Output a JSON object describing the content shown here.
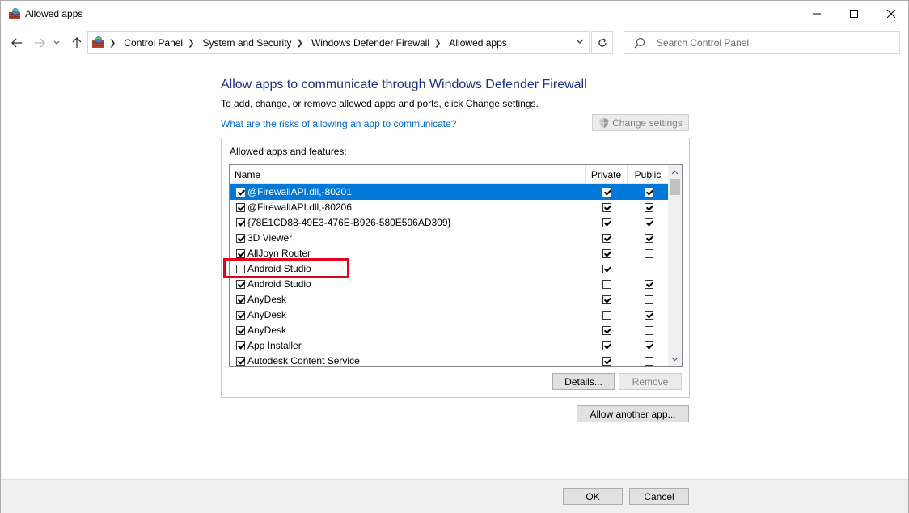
{
  "window": {
    "title": "Allowed apps"
  },
  "nav": {
    "breadcrumbs": [
      "Control Panel",
      "System and Security",
      "Windows Defender Firewall",
      "Allowed apps"
    ],
    "search_placeholder": "Search Control Panel"
  },
  "content": {
    "heading": "Allow apps to communicate through Windows Defender Firewall",
    "subtext": "To add, change, or remove allowed apps and ports, click Change settings.",
    "risk_link": "What are the risks of allowing an app to communicate?",
    "change_settings_label": "Change settings",
    "group_label": "Allowed apps and features:",
    "columns": {
      "name": "Name",
      "private": "Private",
      "public": "Public"
    },
    "apps": [
      {
        "name": "@FirewallAPI.dll,-80201",
        "enabled": true,
        "private": true,
        "public": true,
        "selected": true
      },
      {
        "name": "@FirewallAPI.dll,-80206",
        "enabled": true,
        "private": true,
        "public": true
      },
      {
        "name": "{78E1CD88-49E3-476E-B926-580E596AD309}",
        "enabled": true,
        "private": true,
        "public": true
      },
      {
        "name": "3D Viewer",
        "enabled": true,
        "private": true,
        "public": true
      },
      {
        "name": "AllJoyn Router",
        "enabled": true,
        "private": true,
        "public": false
      },
      {
        "name": "Android Studio",
        "enabled": false,
        "private": true,
        "public": false
      },
      {
        "name": "Android Studio",
        "enabled": true,
        "private": false,
        "public": true
      },
      {
        "name": "AnyDesk",
        "enabled": true,
        "private": true,
        "public": false
      },
      {
        "name": "AnyDesk",
        "enabled": true,
        "private": false,
        "public": true
      },
      {
        "name": "AnyDesk",
        "enabled": true,
        "private": true,
        "public": false
      },
      {
        "name": "App Installer",
        "enabled": true,
        "private": true,
        "public": true
      },
      {
        "name": "Autodesk Content Service",
        "enabled": true,
        "private": true,
        "public": false
      }
    ],
    "details_label": "Details...",
    "remove_label": "Remove",
    "allow_another_label": "Allow another app..."
  },
  "footer": {
    "ok_label": "OK",
    "cancel_label": "Cancel"
  },
  "colors": {
    "heading": "#1e3287",
    "link": "#0066cc",
    "selection": "#0078d7",
    "highlight": "#e00020"
  }
}
